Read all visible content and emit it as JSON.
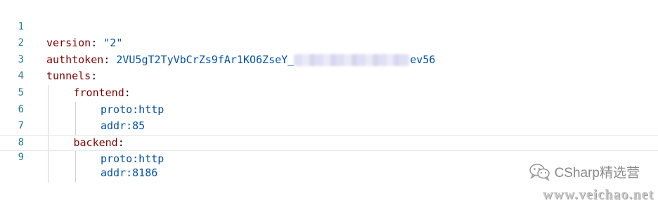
{
  "editor": {
    "lines": [
      {
        "num": "1",
        "key": "version",
        "sep": ": ",
        "value": "\"2\""
      },
      {
        "num": "2",
        "key": "authtoken",
        "sep": ": ",
        "value_prefix": "2VU5gT2TyVbCrZs9fAr1KO6ZseY_",
        "value_suffix": "ev56"
      },
      {
        "num": "3",
        "key": "tunnels",
        "sep": ":"
      },
      {
        "num": "4",
        "key": "frontend",
        "sep": ":"
      },
      {
        "num": "5",
        "value": "proto:http"
      },
      {
        "num": "6",
        "value": "addr:85"
      },
      {
        "num": "7",
        "key": "backend",
        "sep": ":"
      },
      {
        "num": "8",
        "value": "proto:http"
      },
      {
        "num": "9",
        "value": "addr:8186"
      }
    ]
  },
  "watermark": {
    "brand": "CSharp精选营",
    "url": "www.veichao.net",
    "icon": "wechat-icon"
  },
  "colors": {
    "line_number": "#237893",
    "key": "#800000",
    "value": "#0451a5"
  }
}
